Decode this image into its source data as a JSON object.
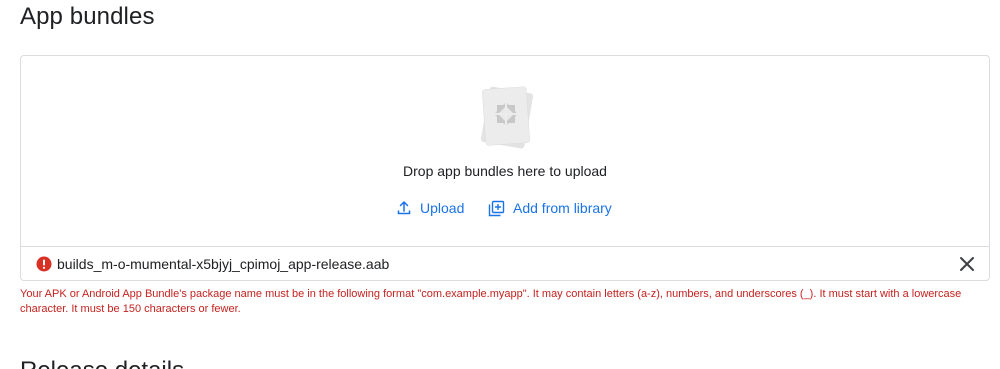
{
  "app_bundles": {
    "title": "App bundles",
    "drop_text": "Drop app bundles here to upload",
    "upload_label": "Upload",
    "add_from_library_label": "Add from library",
    "file": {
      "name": "builds_m-o-mumental-x5bjyj_cpimoj_app-release.aab",
      "status_icon": "error-icon"
    },
    "error_message": "Your APK or Android App Bundle's package name must be in the following format \"com.example.myapp\". It may contain letters (a-z), numbers, and underscores (_). It must start with a lowercase character. It must be 150 characters or fewer."
  },
  "release_details": {
    "title": "Release details"
  },
  "colors": {
    "link": "#1a73e8",
    "error": "#c5221f",
    "border": "#dadce0",
    "text": "#202124"
  }
}
